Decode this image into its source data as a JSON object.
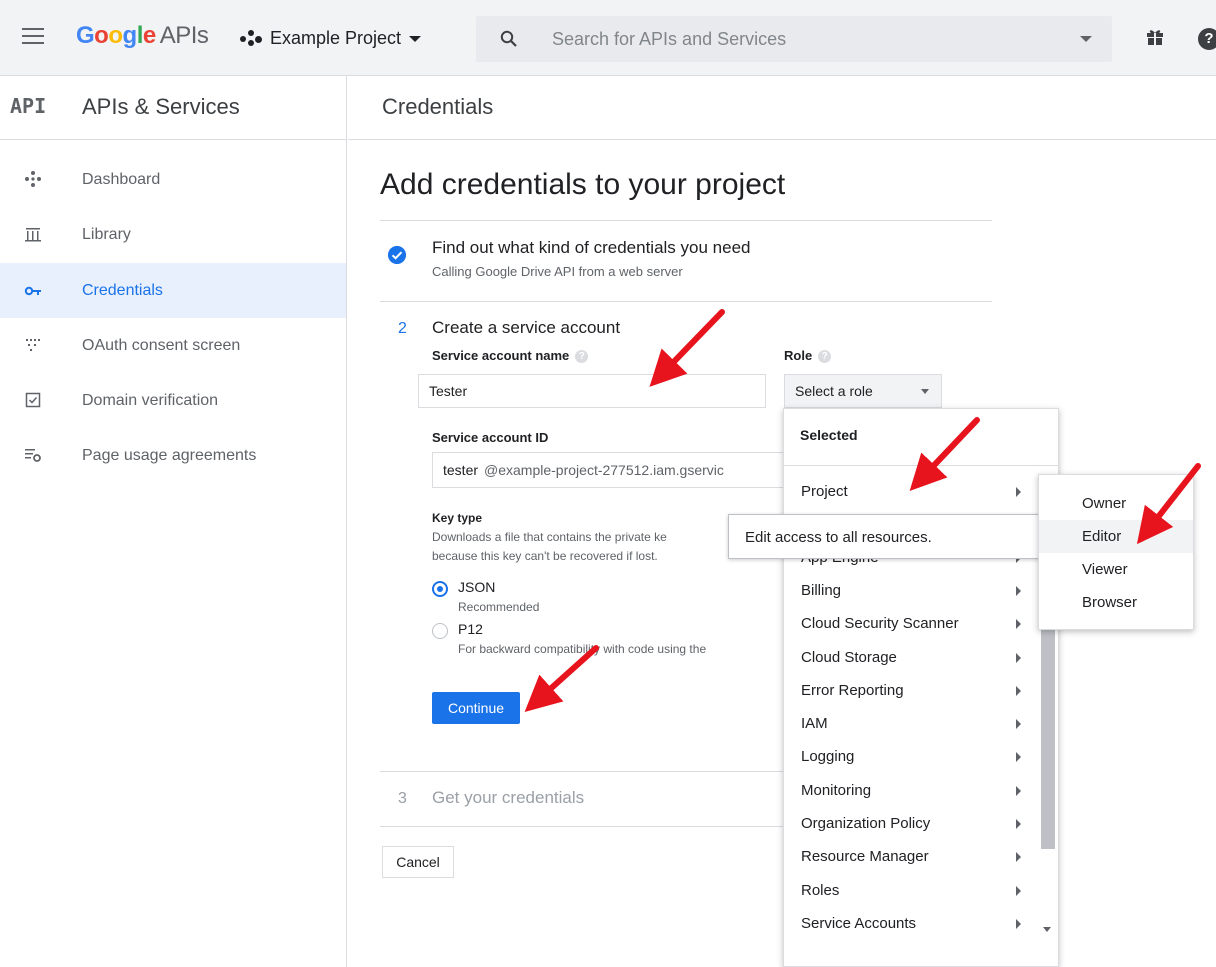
{
  "topbar": {
    "brand_google": "Google",
    "brand_apis": "APIs",
    "project_name": "Example Project",
    "search_placeholder": "Search for APIs and Services",
    "help_glyph": "?"
  },
  "sidebar": {
    "api_badge": "API",
    "title": "APIs & Services",
    "items": [
      {
        "label": "Dashboard",
        "icon": "dashboard-icon"
      },
      {
        "label": "Library",
        "icon": "library-icon"
      },
      {
        "label": "Credentials",
        "icon": "key-icon",
        "active": true
      },
      {
        "label": "OAuth consent screen",
        "icon": "oauth-icon"
      },
      {
        "label": "Domain verification",
        "icon": "domain-check-icon"
      },
      {
        "label": "Page usage agreements",
        "icon": "settings-list-icon"
      }
    ]
  },
  "main": {
    "header": "Credentials",
    "heading": "Add credentials to your project",
    "step1": {
      "title": "Find out what kind of credentials you need",
      "subtitle": "Calling Google Drive API from a web server"
    },
    "step2": {
      "number": "2",
      "title": "Create a service account",
      "account_name_label": "Service account name",
      "account_name_value": "Tester",
      "role_label": "Role",
      "role_select": "Select a role",
      "account_id_label": "Service account ID",
      "account_id_prefix": "tester",
      "account_id_suffix": "@example-project-277512.iam.gservic",
      "key_type_label": "Key type",
      "key_type_desc_line1": "Downloads a file that contains the private ke",
      "key_type_desc_line2": "because this key can't be recovered if lost.",
      "option_json": "JSON",
      "option_json_sub": "Recommended",
      "option_p12": "P12",
      "option_p12_sub": "For backward compatibility with code using the",
      "continue_label": "Continue"
    },
    "step3": {
      "number": "3",
      "title": "Get your credentials"
    },
    "cancel_label": "Cancel"
  },
  "role_dropdown": {
    "selected_header": "Selected",
    "items": [
      "Project",
      "App Engine",
      "Billing",
      "Cloud Security Scanner",
      "Cloud Storage",
      "Error Reporting",
      "IAM",
      "Logging",
      "Monitoring",
      "Organization Policy",
      "Resource Manager",
      "Roles",
      "Service Accounts"
    ],
    "tooltip": "Edit access to all resources."
  },
  "project_submenu": {
    "items": [
      "Owner",
      "Editor",
      "Viewer",
      "Browser"
    ],
    "hovered": "Editor"
  },
  "colors": {
    "accent": "#1a73e8",
    "annotation_arrow": "#e8141d"
  }
}
